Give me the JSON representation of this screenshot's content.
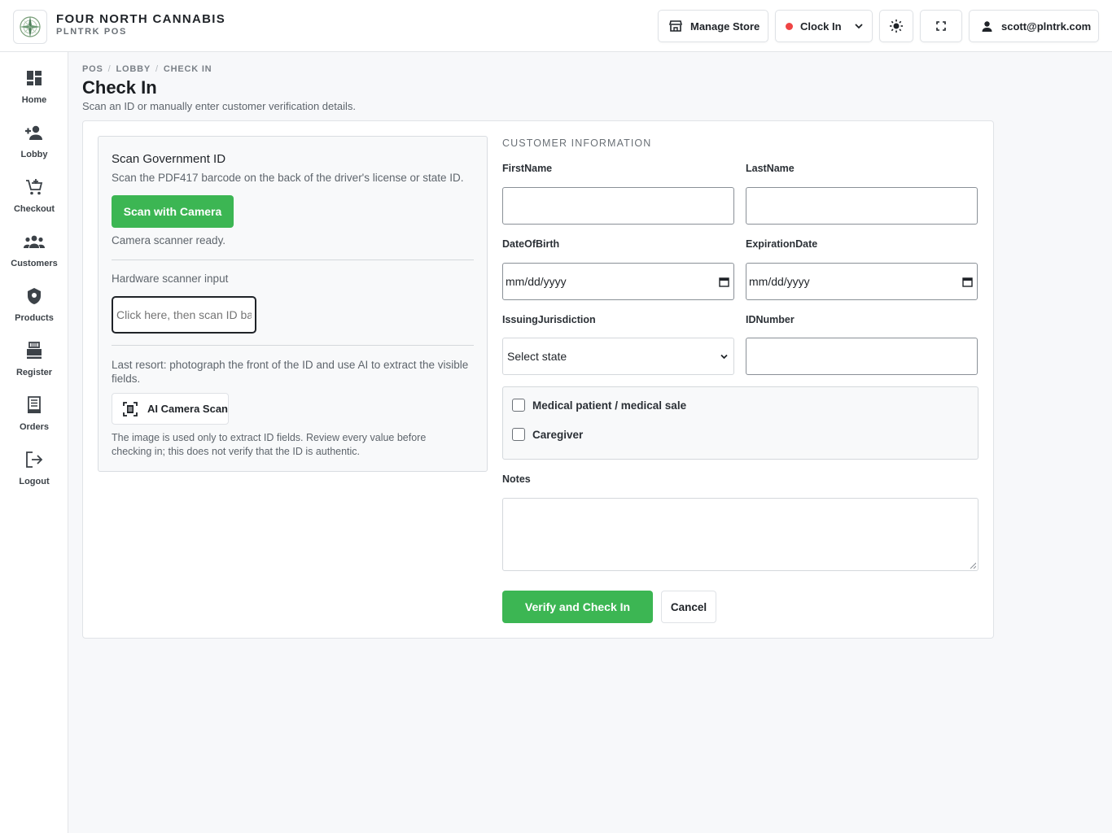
{
  "header": {
    "brand_name": "FOUR NORTH CANNABIS",
    "brand_sub": "PLNTRK POS",
    "manage_store": "Manage Store",
    "clock_in": "Clock In",
    "user_email": "scott@plntrk.com"
  },
  "sidebar": {
    "items": [
      {
        "label": "Home",
        "icon": "dashboard-icon"
      },
      {
        "label": "Lobby",
        "icon": "person-add-icon"
      },
      {
        "label": "Checkout",
        "icon": "cart-icon"
      },
      {
        "label": "Customers",
        "icon": "group-icon"
      },
      {
        "label": "Products",
        "icon": "flower-icon"
      },
      {
        "label": "Register",
        "icon": "register-icon"
      },
      {
        "label": "Orders",
        "icon": "receipt-icon"
      },
      {
        "label": "Logout",
        "icon": "logout-icon"
      }
    ]
  },
  "breadcrumb": [
    "POS",
    "LOBBY",
    "CHECK IN"
  ],
  "page": {
    "title": "Check In",
    "subtitle": "Scan an ID or manually enter customer verification details."
  },
  "scan": {
    "title": "Scan Government ID",
    "description": "Scan the PDF417 barcode on the back of the driver's license or state ID.",
    "scan_button": "Scan with Camera",
    "status": "Camera scanner ready.",
    "hardware_label": "Hardware scanner input",
    "hardware_placeholder": "Click here, then scan ID barcode",
    "last_resort": "Last resort: photograph the front of the ID and use AI to extract the visible fields.",
    "ai_button": "AI Camera Scan",
    "ai_note": "The image is used only to extract ID fields. Review every value before checking in; this does not verify that the ID is authentic."
  },
  "customer": {
    "section_title": "CUSTOMER INFORMATION",
    "first_name_label": "FirstName",
    "first_name_value": "",
    "last_name_label": "LastName",
    "last_name_value": "",
    "dob_label": "DateOfBirth",
    "dob_placeholder": "mm/dd/yyyy",
    "expiration_label": "ExpirationDate",
    "expiration_placeholder": "mm/dd/yyyy",
    "jurisdiction_label": "IssuingJurisdiction",
    "jurisdiction_selected": "Select state",
    "id_number_label": "IDNumber",
    "id_number_value": "",
    "medical_label": "Medical patient / medical sale",
    "medical_checked": false,
    "caregiver_label": "Caregiver",
    "caregiver_checked": false,
    "notes_label": "Notes",
    "notes_value": ""
  },
  "actions": {
    "verify": "Verify and Check In",
    "cancel": "Cancel"
  },
  "colors": {
    "accent_green": "#3cb653",
    "clock_dot": "#ef4444",
    "background": "#f7f8fa"
  }
}
